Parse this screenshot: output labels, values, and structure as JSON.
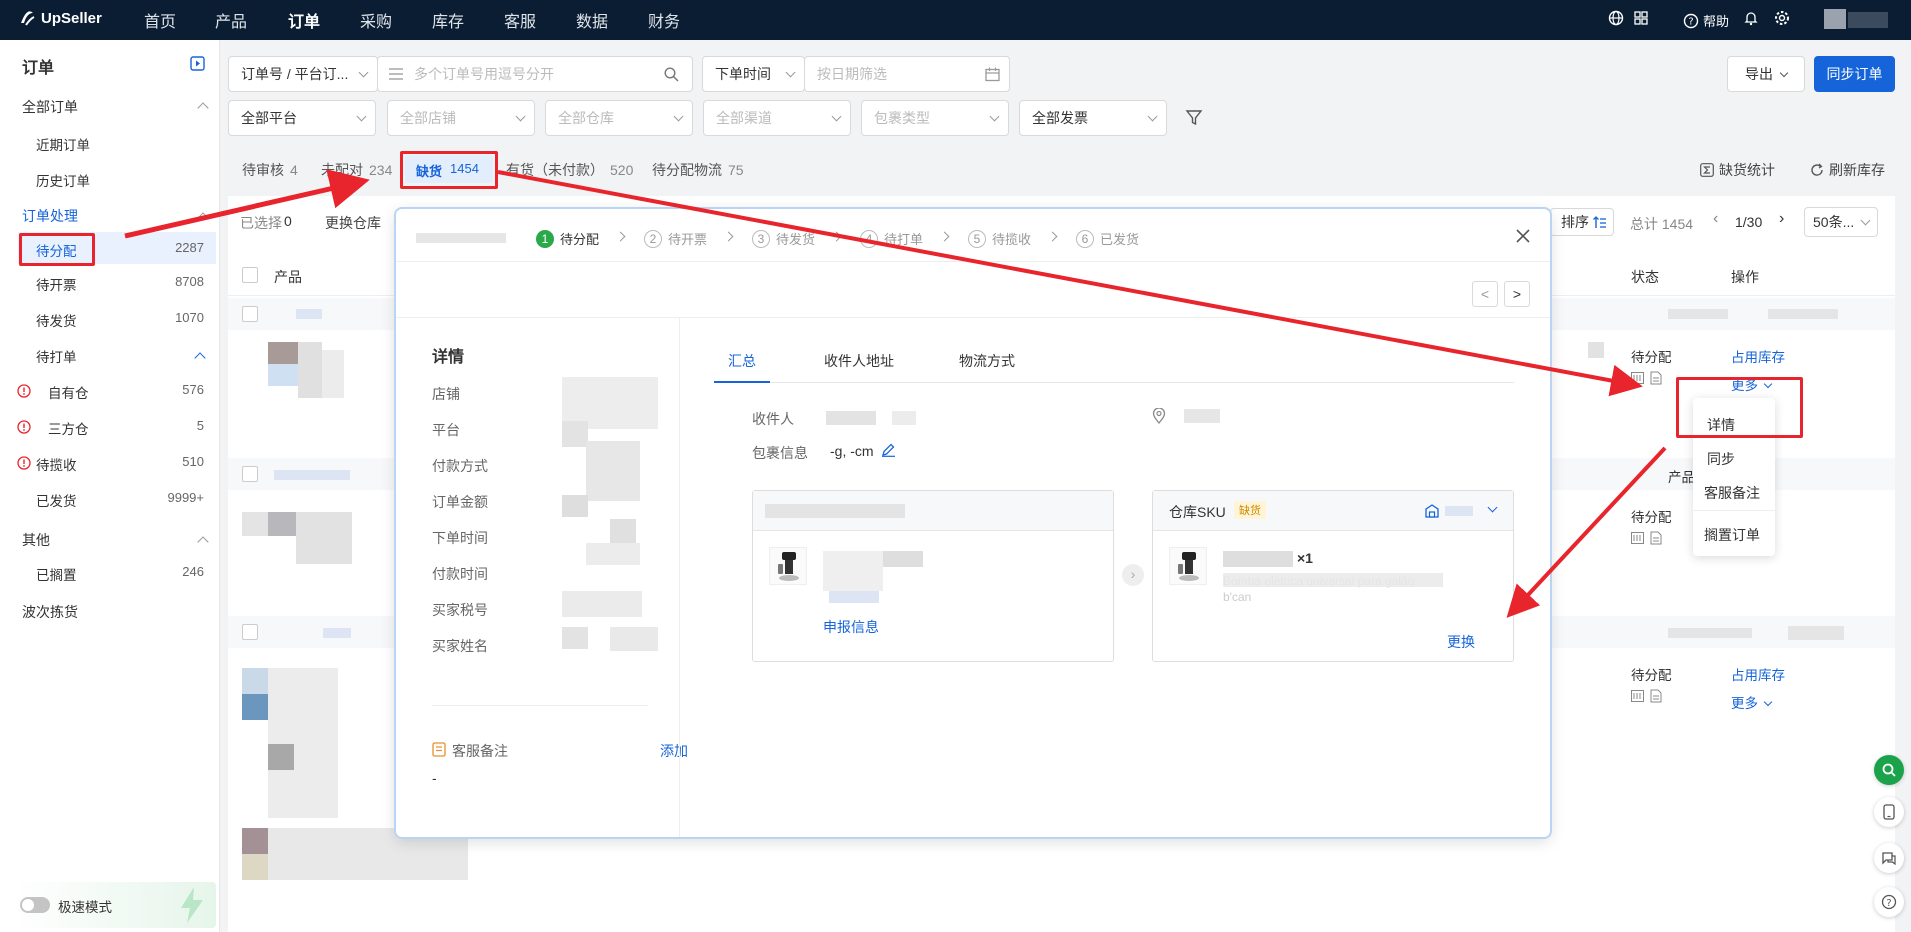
{
  "app": {
    "logo": "UpSeller"
  },
  "nav": [
    "首页",
    "产品",
    "订单",
    "采购",
    "库存",
    "客服",
    "数据",
    "财务"
  ],
  "top_right": {
    "help": "帮助"
  },
  "sidebar": {
    "title": "订单",
    "all_orders": "全部订单",
    "recent": "近期订单",
    "history": "历史订单",
    "processing": "订单处理",
    "items": [
      {
        "label": "待分配",
        "count": "2287"
      },
      {
        "label": "待开票",
        "count": "8708"
      },
      {
        "label": "待发货",
        "count": "1070"
      },
      {
        "label": "待打单",
        "count": ""
      },
      {
        "label": "自有仓",
        "count": "576"
      },
      {
        "label": "三方仓",
        "count": "5"
      },
      {
        "label": "待揽收",
        "count": "510"
      },
      {
        "label": "已发货",
        "count": "9999+"
      }
    ],
    "other": "其他",
    "shelved": {
      "label": "已搁置",
      "count": "246"
    },
    "wave": "波次拣货",
    "fast_mode": "极速模式"
  },
  "filters": {
    "order_type": "订单号 / 平台订...",
    "search_placeholder": "多个订单号用逗号分开",
    "time_type": "下单时间",
    "date_placeholder": "按日期筛选",
    "platform": "全部平台",
    "store": "全部店铺",
    "warehouse": "全部仓库",
    "channel": "全部渠道",
    "package": "包裹类型",
    "invoice": "全部发票",
    "export": "导出",
    "sync": "同步订单"
  },
  "tabs": [
    {
      "label": "待审核",
      "count": "4"
    },
    {
      "label": "未配对",
      "count": "234"
    },
    {
      "label": "缺货",
      "count": "1454"
    },
    {
      "label": "有货（未付款）",
      "count": "520"
    },
    {
      "label": "待分配物流",
      "count": "75"
    }
  ],
  "tab_actions": {
    "stats": "缺货统计",
    "refresh": "刷新库存"
  },
  "table": {
    "selected_label": "已选择",
    "selected_count": "0",
    "change_warehouse": "更换仓库",
    "sort": "排序",
    "total": "总计 1454",
    "page": "1/30",
    "page_size": "50条...",
    "col_product": "产品",
    "col_status": "状态",
    "col_action": "操作",
    "col_product2": "产品",
    "rows": [
      {
        "status": "待分配",
        "action": "占用库存",
        "more": "更多"
      },
      {
        "status": "待分配",
        "action": "占用库存",
        "more": ""
      },
      {
        "status": "待分配",
        "action": "占用库存",
        "more": "更多"
      }
    ]
  },
  "menu": [
    "详情",
    "同步",
    "客服备注",
    "搁置订单"
  ],
  "modal": {
    "steps": [
      {
        "n": "1",
        "label": "待分配"
      },
      {
        "n": "2",
        "label": "待开票"
      },
      {
        "n": "3",
        "label": "待发货"
      },
      {
        "n": "4",
        "label": "待打单"
      },
      {
        "n": "5",
        "label": "待揽收"
      },
      {
        "n": "6",
        "label": "已发货"
      }
    ],
    "details_title": "详情",
    "detail_labels": [
      "店铺",
      "平台",
      "付款方式",
      "订单金额",
      "下单时间",
      "付款时间",
      "买家税号",
      "买家姓名"
    ],
    "cs_note": "客服备注",
    "cs_add": "添加",
    "cs_value": "-",
    "tabs": [
      "汇总",
      "收件人地址",
      "物流方式"
    ],
    "recipient_label": "收件人",
    "package_label": "包裹信息",
    "package_value": "-g, -cm",
    "declare": "申报信息",
    "sku_title": "仓库SKU",
    "sku_badge": "缺货",
    "sku_qty": "×1",
    "sku_desc": "Bomba elétrica universal para galão",
    "sku_desc2": "b'can",
    "replace": "更换"
  },
  "colors": {
    "accent": "#1664d9",
    "topbar": "#0b1d33",
    "annotation": "#e8242d",
    "green": "#2aa84a"
  }
}
